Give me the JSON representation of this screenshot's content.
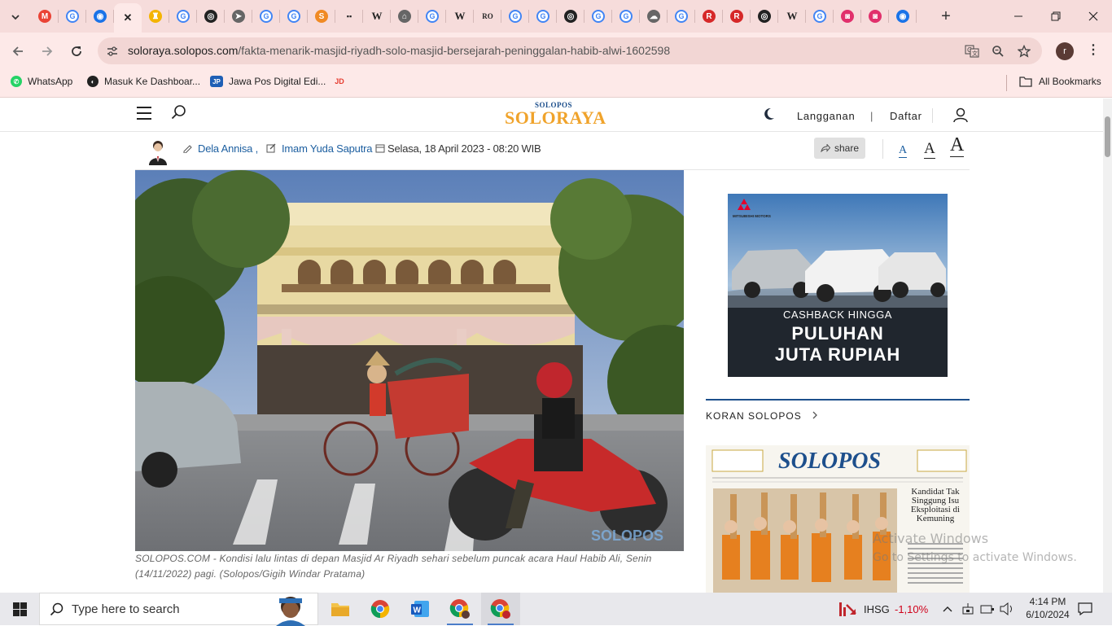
{
  "browser": {
    "tabs": [
      {
        "icon": "chevron-down-icon"
      },
      {
        "icon": "gmail-icon",
        "color": "#ea4335"
      },
      {
        "icon": "google-icon",
        "color": "#4285f4"
      },
      {
        "icon": "globe-icon",
        "color": "#1a73e8"
      },
      {
        "icon": "close-icon",
        "active": true
      },
      {
        "icon": "shield-icon",
        "color": "#f4b400"
      },
      {
        "icon": "google-icon"
      },
      {
        "icon": "circle-icon"
      },
      {
        "icon": "arrow-icon"
      },
      {
        "icon": "google-icon"
      },
      {
        "icon": "google-icon"
      },
      {
        "icon": "s-icon",
        "color": "#f08a24"
      },
      {
        "icon": "dots-icon"
      },
      {
        "icon": "wikipedia-icon"
      },
      {
        "icon": "home-icon"
      },
      {
        "icon": "google-icon"
      },
      {
        "icon": "wikipedia-icon"
      },
      {
        "icon": "ro-icon"
      },
      {
        "icon": "google-icon"
      },
      {
        "icon": "google-icon"
      },
      {
        "icon": "circle-icon"
      },
      {
        "icon": "google-icon"
      },
      {
        "icon": "google-icon"
      },
      {
        "icon": "cloud-icon"
      },
      {
        "icon": "google-icon"
      },
      {
        "icon": "r-icon",
        "color": "#d62828"
      },
      {
        "icon": "r-icon",
        "color": "#d62828"
      },
      {
        "icon": "circle-icon"
      },
      {
        "icon": "wikipedia-icon"
      },
      {
        "icon": "google-icon"
      },
      {
        "icon": "instagram-icon",
        "color": "#e1306c"
      },
      {
        "icon": "instagram-icon",
        "color": "#e1306c"
      },
      {
        "icon": "globe-icon",
        "color": "#1a73e8"
      }
    ],
    "url_domain": "soloraya.solopos.com",
    "url_path": "/fakta-menarik-masjid-riyadh-solo-masjid-bersejarah-peninggalan-habib-alwi-1602598",
    "profile_initial": "r",
    "bookmarks": [
      {
        "label": "WhatsApp",
        "icon": "whatsapp-icon",
        "color": "#25d366"
      },
      {
        "label": "Masuk Ke Dashboar...",
        "icon": "dashboard-icon",
        "color": "#222222"
      },
      {
        "label": "Jawa Pos Digital Edi...",
        "icon": "jp-icon",
        "color": "#1f5fb5"
      },
      {
        "label": "",
        "icon": "jd-icon",
        "color": "#e63b2e"
      }
    ],
    "all_bookmarks": "All Bookmarks"
  },
  "site": {
    "logo_small": "SOLOPOS",
    "logo_big": "SOLORAYA",
    "subscribe": "Langganan",
    "separator": "|",
    "register": "Daftar"
  },
  "article": {
    "author": "Dela Annisa ,",
    "editor": "Imam Yuda Saputra",
    "date": "Selasa, 18 April 2023 - 08:20 WIB",
    "share": "share",
    "font_small": "A",
    "font_medium": "A",
    "font_large": "A",
    "image_watermark": "SOLOPOS",
    "caption": "SOLOPOS.COM - Kondisi lalu lintas di depan Masjid Ar Riyadh sehari sebelum puncak acara Haul Habib Ali, Senin (14/11/2022) pagi. (Solopos/Gigih Windar Pratama)"
  },
  "sidebar": {
    "ad_brand": "MITSUBISHI MOTORS",
    "ad_line1": "CASHBACK HINGGA",
    "ad_line2": "PULUHAN",
    "ad_line3": "JUTA RUPIAH",
    "koran_title": "KORAN SOLOPOS",
    "paper_masthead": "SOLOPOS",
    "paper_headline": "Kandidat Tak Singgung Isu Eksploitasi di Kemuning"
  },
  "watermark": {
    "line1": "Activate Windows",
    "line2": "Go to Settings to activate Windows."
  },
  "taskbar": {
    "search_placeholder": "Type here to search",
    "stock_name": "IHSG",
    "stock_change": "-1,10%",
    "time": "4:14 PM",
    "date": "6/10/2024"
  },
  "colors": {
    "accent": "#1d4f8c",
    "logo_orange": "#f0a32b",
    "stock_down": "#d0021b"
  }
}
